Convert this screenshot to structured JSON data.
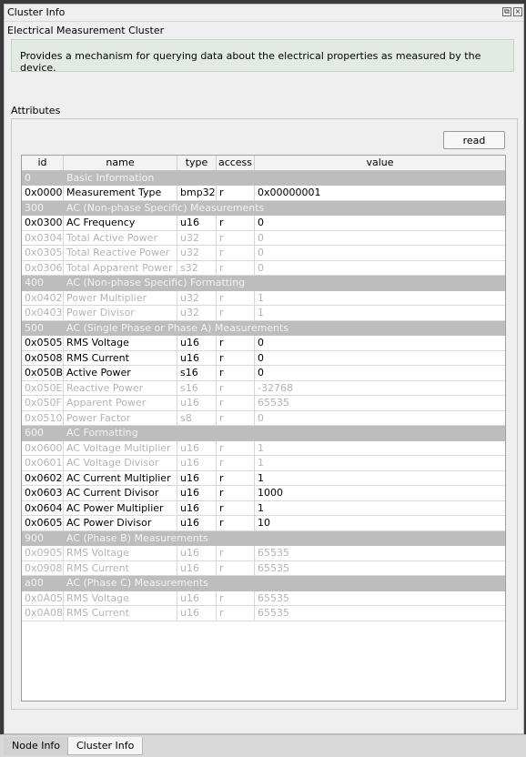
{
  "window": {
    "title": "Cluster Info",
    "float_icon": "⧉",
    "close_icon": "×"
  },
  "cluster": {
    "name": "Electrical Measurement Cluster",
    "description": "Provides a mechanism for querying data about the electrical properties as measured by the device."
  },
  "attributes": {
    "label": "Attributes",
    "read_label": "read",
    "columns": [
      "id",
      "name",
      "type",
      "access",
      "value"
    ],
    "rows": [
      {
        "kind": "group",
        "id": "0",
        "name": "Basic Information"
      },
      {
        "kind": "active",
        "id": "0x0000",
        "name": "Measurement Type",
        "type": "bmp32",
        "access": "r",
        "value": "0x00000001"
      },
      {
        "kind": "group",
        "id": "300",
        "name": "AC (Non-phase Specific) Measurements"
      },
      {
        "kind": "active",
        "id": "0x0300",
        "name": "AC Frequency",
        "type": "u16",
        "access": "r",
        "value": "0"
      },
      {
        "kind": "disabled",
        "id": "0x0304",
        "name": "Total Active Power",
        "type": "u32",
        "access": "r",
        "value": "0"
      },
      {
        "kind": "disabled",
        "id": "0x0305",
        "name": "Total Reactive Power",
        "type": "u32",
        "access": "r",
        "value": "0"
      },
      {
        "kind": "disabled",
        "id": "0x0306",
        "name": "Total Apparent Power",
        "type": "s32",
        "access": "r",
        "value": "0"
      },
      {
        "kind": "group",
        "id": "400",
        "name": "AC (Non-phase Specific) Formatting"
      },
      {
        "kind": "disabled",
        "id": "0x0402",
        "name": "Power Multiplier",
        "type": "u32",
        "access": "r",
        "value": "1"
      },
      {
        "kind": "disabled",
        "id": "0x0403",
        "name": "Power Divisor",
        "type": "u32",
        "access": "r",
        "value": "1"
      },
      {
        "kind": "group",
        "id": "500",
        "name": "AC (Single Phase or Phase A) Measurements"
      },
      {
        "kind": "active",
        "id": "0x0505",
        "name": "RMS Voltage",
        "type": "u16",
        "access": "r",
        "value": "0"
      },
      {
        "kind": "active",
        "id": "0x0508",
        "name": "RMS Current",
        "type": "u16",
        "access": "r",
        "value": "0"
      },
      {
        "kind": "active",
        "id": "0x050B",
        "name": "Active Power",
        "type": "s16",
        "access": "r",
        "value": "0"
      },
      {
        "kind": "disabled",
        "id": "0x050E",
        "name": "Reactive Power",
        "type": "s16",
        "access": "r",
        "value": "-32768"
      },
      {
        "kind": "disabled",
        "id": "0x050F",
        "name": "Apparent Power",
        "type": "u16",
        "access": "r",
        "value": "65535"
      },
      {
        "kind": "disabled",
        "id": "0x0510",
        "name": "Power Factor",
        "type": "s8",
        "access": "r",
        "value": "0"
      },
      {
        "kind": "group",
        "id": "600",
        "name": "AC Formatting"
      },
      {
        "kind": "disabled",
        "id": "0x0600",
        "name": "AC Voltage Multiplier",
        "type": "u16",
        "access": "r",
        "value": "1"
      },
      {
        "kind": "disabled",
        "id": "0x0601",
        "name": "AC Voltage Divisor",
        "type": "u16",
        "access": "r",
        "value": "1"
      },
      {
        "kind": "active",
        "id": "0x0602",
        "name": "AC Current Multiplier",
        "type": "u16",
        "access": "r",
        "value": "1"
      },
      {
        "kind": "active",
        "id": "0x0603",
        "name": "AC Current Divisor",
        "type": "u16",
        "access": "r",
        "value": "1000"
      },
      {
        "kind": "active",
        "id": "0x0604",
        "name": "AC Power Multiplier",
        "type": "u16",
        "access": "r",
        "value": "1"
      },
      {
        "kind": "active",
        "id": "0x0605",
        "name": "AC Power Divisor",
        "type": "u16",
        "access": "r",
        "value": "10"
      },
      {
        "kind": "group",
        "id": "900",
        "name": "AC (Phase B) Measurements"
      },
      {
        "kind": "disabled",
        "id": "0x0905",
        "name": "RMS Voltage",
        "type": "u16",
        "access": "r",
        "value": "65535"
      },
      {
        "kind": "disabled",
        "id": "0x0908",
        "name": "RMS Current",
        "type": "u16",
        "access": "r",
        "value": "65535"
      },
      {
        "kind": "group",
        "id": "a00",
        "name": "AC (Phase C) Measurements"
      },
      {
        "kind": "disabled",
        "id": "0x0A05",
        "name": "RMS Voltage",
        "type": "u16",
        "access": "r",
        "value": "65535"
      },
      {
        "kind": "disabled",
        "id": "0x0A08",
        "name": "RMS Current",
        "type": "u16",
        "access": "r",
        "value": "65535"
      }
    ]
  },
  "tabs": [
    {
      "label": "Node Info",
      "active": false
    },
    {
      "label": "Cluster Info",
      "active": true
    }
  ]
}
